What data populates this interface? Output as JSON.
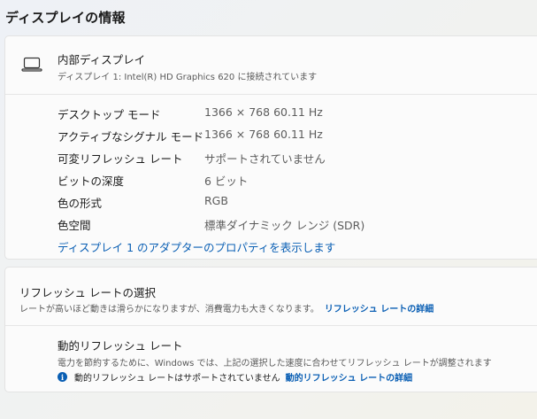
{
  "page_title": "ディスプレイの情報",
  "display": {
    "icon": "laptop-icon",
    "name": "内部ディスプレイ",
    "subtitle": "ディスプレイ 1: Intel(R) HD Graphics 620 に接続されています",
    "rows": [
      {
        "label": "デスクトップ モード",
        "value": "1366 × 768 60.11 Hz"
      },
      {
        "label": "アクティブなシグナル モード",
        "value": "1366 × 768 60.11 Hz"
      },
      {
        "label": "可変リフレッシュ レート",
        "value": "サポートされていません"
      },
      {
        "label": "ビットの深度",
        "value": "6 ビット"
      },
      {
        "label": "色の形式",
        "value": "RGB"
      },
      {
        "label": "色空間",
        "value": "標準ダイナミック レンジ (SDR)"
      }
    ],
    "adapter_link": "ディスプレイ 1 のアダプターのプロパティを表示します"
  },
  "refresh": {
    "title": "リフレッシュ レートの選択",
    "description": "レートが高いほど動きは滑らかになりますが、消費電力も大きくなります。",
    "details_link": "リフレッシュ レートの詳細",
    "dynamic": {
      "title": "動的リフレッシュ レート",
      "description": "電力を節約するために、Windows では、上記の選択した速度に合わせてリフレッシュ レートが調整されます",
      "note": "動的リフレッシュ レートはサポートされていません",
      "note_icon": "info-icon",
      "note_link": "動的リフレッシュ レートの詳細"
    }
  }
}
